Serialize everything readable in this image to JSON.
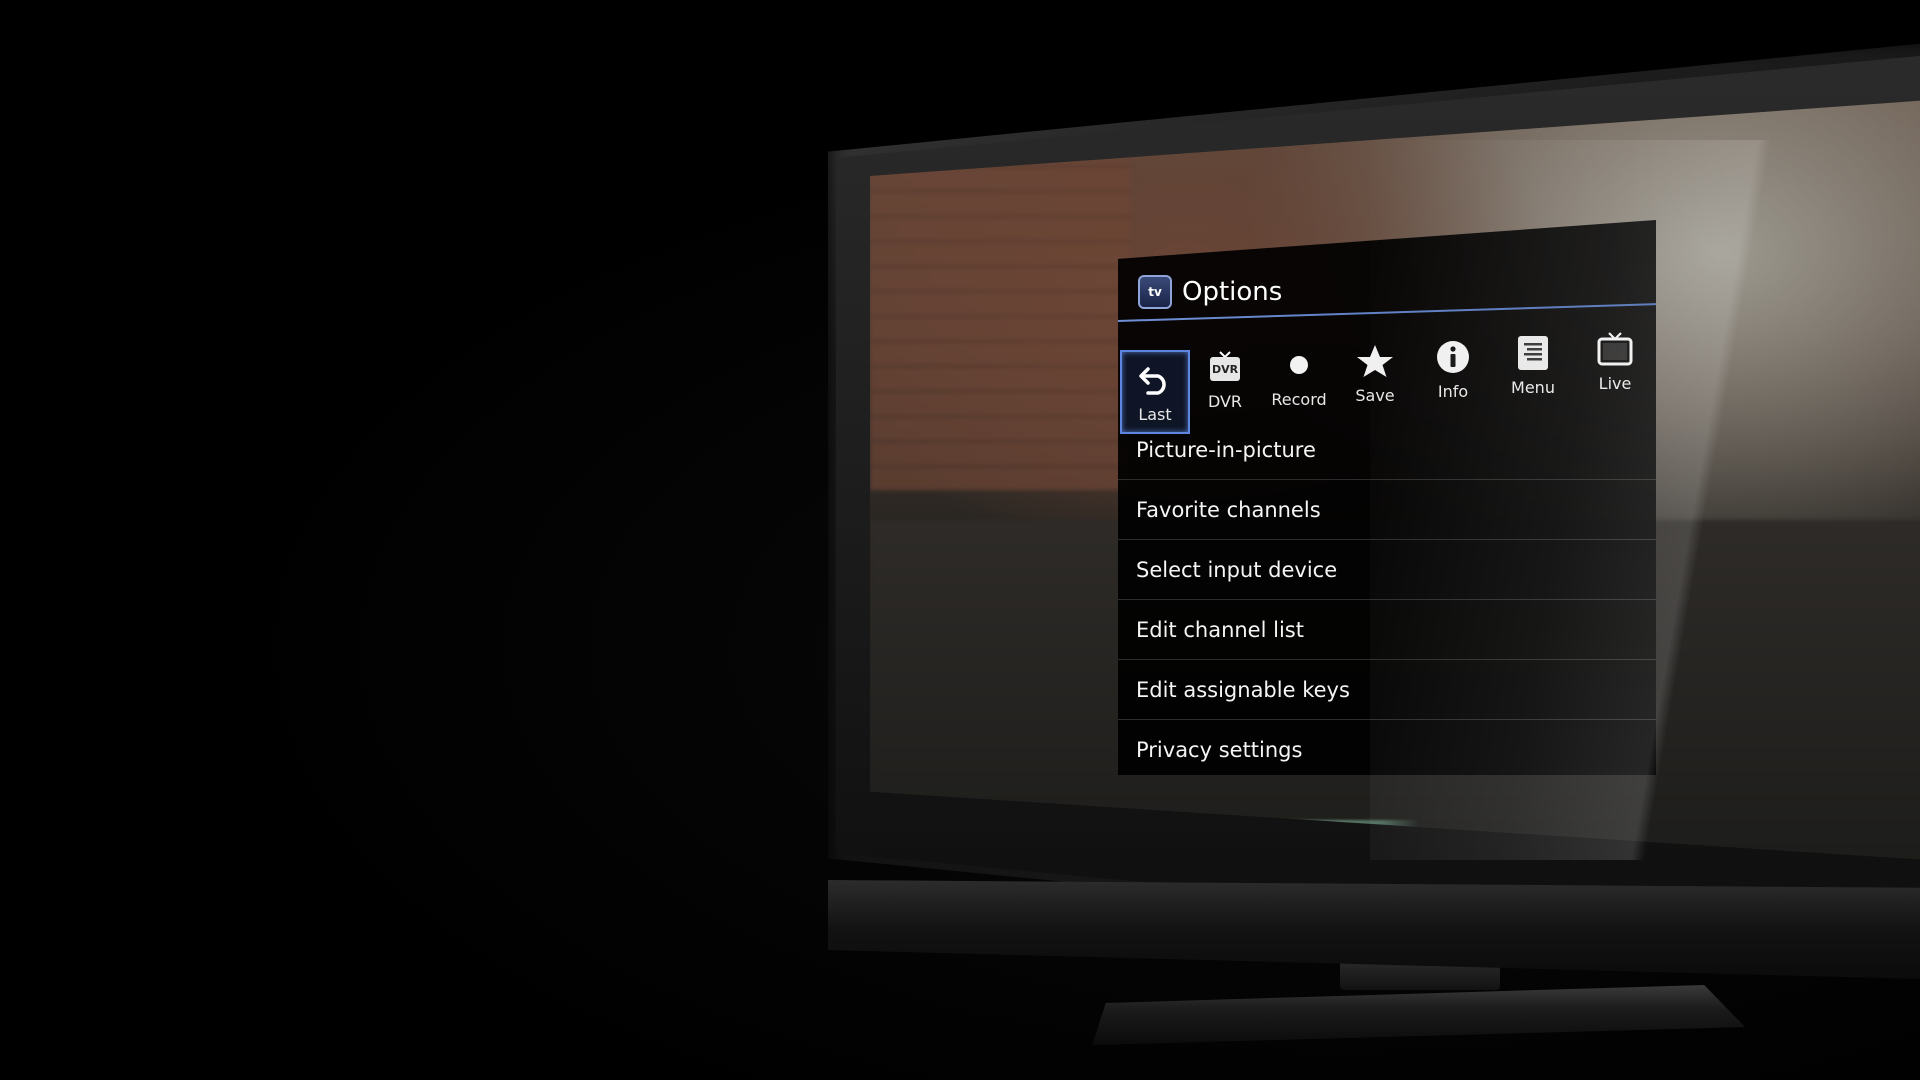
{
  "options_panel": {
    "app_icon_text": "tv",
    "title": "Options"
  },
  "toolbar": {
    "buttons": [
      {
        "label": "Last",
        "icon": "undo-arrow-icon"
      },
      {
        "label": "DVR",
        "icon": "dvr-icon",
        "icon_text": "DVR"
      },
      {
        "label": "Record",
        "icon": "record-dot-icon"
      },
      {
        "label": "Save",
        "icon": "star-icon"
      },
      {
        "label": "Info",
        "icon": "info-icon"
      },
      {
        "label": "Menu",
        "icon": "menu-list-icon"
      },
      {
        "label": "Live",
        "icon": "tv-icon"
      }
    ],
    "selected": "Last"
  },
  "menu": {
    "items": [
      {
        "label": "Picture-in-picture"
      },
      {
        "label": "Favorite channels"
      },
      {
        "label": "Select input device"
      },
      {
        "label": "Edit channel list"
      },
      {
        "label": "Edit assignable keys"
      },
      {
        "label": "Privacy settings"
      }
    ]
  },
  "colors": {
    "highlight_border": "#5d86e0",
    "panel_background": "#000000",
    "text": "#f2f2f2"
  }
}
